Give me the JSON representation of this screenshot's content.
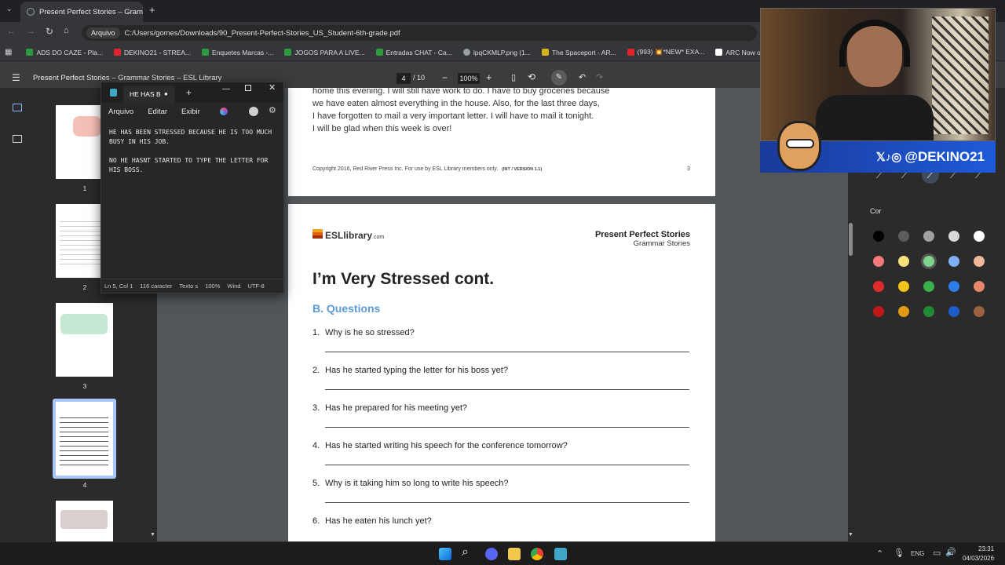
{
  "browser": {
    "tab_title": "Present Perfect Stories – Gramm",
    "address_chip": "Arquivo",
    "url": "C:/Users/gomes/Downloads/90_Present-Perfect-Stories_US_Student-6th-grade.pdf",
    "bookmarks": [
      {
        "label": "ADS DO CAZE - Pla...",
        "color": "#2e9a3e"
      },
      {
        "label": "DEKINO21 - STREA...",
        "color": "#e0232b"
      },
      {
        "label": "Enquetes Marcas -...",
        "color": "#2e9a3e"
      },
      {
        "label": "JOGOS PARA A LIVE...",
        "color": "#2e9a3e"
      },
      {
        "label": "Entradas CHAT - Ca...",
        "color": "#2e9a3e"
      },
      {
        "label": "lpqCKMLP.png (1...",
        "color": "#9aa0a6"
      },
      {
        "label": "The Spaceport - AR...",
        "color": "#d4b21c"
      },
      {
        "label": "(993) 💥*NEW* EXA...",
        "color": "#e0232b"
      },
      {
        "label": "ARC Now on X: \"Co...",
        "color": "#ffffff"
      }
    ]
  },
  "pdf_viewer": {
    "doc_title": "Present Perfect Stories – Grammar Stories – ESL Library",
    "current_page": "4",
    "page_total": "/ 10",
    "zoom": "100%",
    "thumbnails": [
      "1",
      "2",
      "3",
      "4"
    ]
  },
  "page3": {
    "lines": [
      "home this evening. I will still have work to do. I have to buy groceries because",
      "we have eaten almost everything in the house. Also, for the last three days,",
      "I have forgotten to mail a very important letter. I will have to mail it tonight.",
      "I will be glad when this week is over!"
    ],
    "copyright": "Copyright 2016, Red River Press Inc. For use by ESL Library members only.",
    "version": "(INT / VERSION 1.1)",
    "page_number": "3"
  },
  "page4": {
    "logo_text": "ESLlibrary",
    "logo_suffix": ".com",
    "header_title": "Present Perfect Stories",
    "header_subtitle": "Grammar Stories",
    "heading": "I’m Very Stressed cont.",
    "section": "B. Questions",
    "questions": [
      {
        "num": "1.",
        "text": "Why is he so stressed?"
      },
      {
        "num": "2.",
        "text": "Has he started typing the letter for his boss yet?"
      },
      {
        "num": "3.",
        "text": "Has he prepared for his meeting yet?"
      },
      {
        "num": "4.",
        "text": "Has he started writing his speech for the conference tomorrow?"
      },
      {
        "num": "5.",
        "text": "Why is it taking him so long to write his speech?"
      },
      {
        "num": "6.",
        "text": "Has he eaten his lunch yet?"
      }
    ]
  },
  "notepad": {
    "tab_title": "HE HAS B",
    "menu": [
      "Arquivo",
      "Editar",
      "Exibir"
    ],
    "text": "HE HAS BEEN STRESSED BECAUSE HE IS TOO MUCH BUSY IN HIS JOB.\n\nNO HE HASNT STARTED TO TYPE THE LETTER FOR HIS BOSS.",
    "status": [
      "Ln 5, Col 1",
      "116 caracter",
      "Texto s",
      "100%",
      "Wind",
      "UTF-8"
    ]
  },
  "right_panel": {
    "color_label": "Cor",
    "colors": [
      [
        "#000000",
        "#5c5c5c",
        "#a0a0a0",
        "#d8d8d8",
        "#ffffff"
      ],
      [
        "#f47a7a",
        "#f5e27a",
        "#7fd48b",
        "#7fb0f5",
        "#f0b89a"
      ],
      [
        "#e02b2b",
        "#f0c419",
        "#3cae4a",
        "#2e7ce8",
        "#e4876a"
      ],
      [
        "#c01818",
        "#e09a15",
        "#228a34",
        "#1c5bc8",
        "#9a6040"
      ]
    ]
  },
  "stream": {
    "handle": "@DEKINO21"
  },
  "taskbar": {
    "lang": "ENG",
    "time": "23:31",
    "date": "04/03/2026"
  }
}
